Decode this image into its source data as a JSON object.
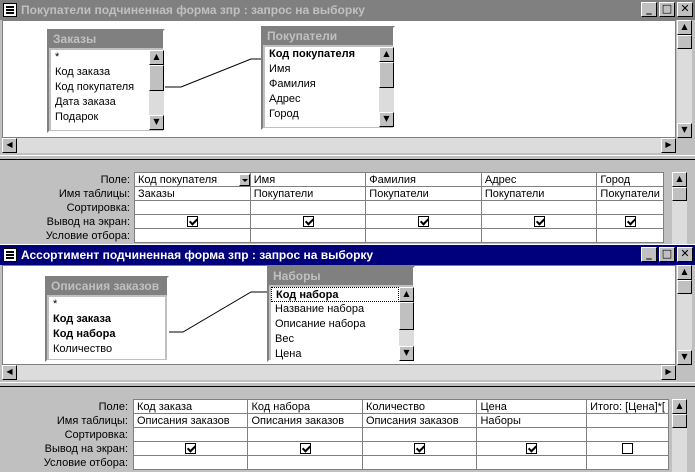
{
  "window1": {
    "title": "Покупатели подчиненная форма зпр : запрос на выборку",
    "buttons": {
      "minimize": "_",
      "maximize": "□",
      "close": "✕"
    },
    "table_orders": {
      "title": "Заказы",
      "fields": [
        "*",
        "Код заказа",
        "Код покупателя",
        "Дата заказа",
        "Подарок"
      ]
    },
    "table_customers": {
      "title": "Покупатели",
      "fields": [
        "Код покупателя",
        "Имя",
        "Фамилия",
        "Адрес",
        "Город"
      ]
    },
    "grid": {
      "row_labels": [
        "Поле:",
        "Имя таблицы:",
        "Сортировка:",
        "Вывод на экран:",
        "Условие отбора:"
      ],
      "columns": [
        {
          "field": "Код покупателя",
          "table": "Заказы",
          "show": true
        },
        {
          "field": "Имя",
          "table": "Покупатели",
          "show": true
        },
        {
          "field": "Фамилия",
          "table": "Покупатели",
          "show": true
        },
        {
          "field": "Адрес",
          "table": "Покупатели",
          "show": true
        },
        {
          "field": "Город",
          "table": "Покупатели",
          "show": true
        }
      ]
    }
  },
  "window2": {
    "title": "Ассортимент подчиненная форма зпр : запрос на выборку",
    "buttons": {
      "minimize": "_",
      "maximize": "□",
      "close": "✕"
    },
    "table_descriptions": {
      "title": "Описания заказов",
      "fields": [
        "*",
        "Код заказа",
        "Код набора",
        "Количество"
      ]
    },
    "table_sets": {
      "title": "Наборы",
      "fields": [
        "Код набора",
        "Название набора",
        "Описание набора",
        "Вес",
        "Цена"
      ]
    },
    "grid": {
      "row_labels": [
        "Поле:",
        "Имя таблицы:",
        "Сортировка:",
        "Вывод на экран:",
        "Условие отбора:"
      ],
      "columns": [
        {
          "field": "Код заказа",
          "table": "Описания заказов",
          "show": true
        },
        {
          "field": "Код набора",
          "table": "Описания заказов",
          "show": true
        },
        {
          "field": "Количество",
          "table": "Описания заказов",
          "show": true
        },
        {
          "field": "Цена",
          "table": "Наборы",
          "show": true
        },
        {
          "field": "Итого: [Цена]*[",
          "table": "",
          "show": false
        }
      ]
    }
  }
}
